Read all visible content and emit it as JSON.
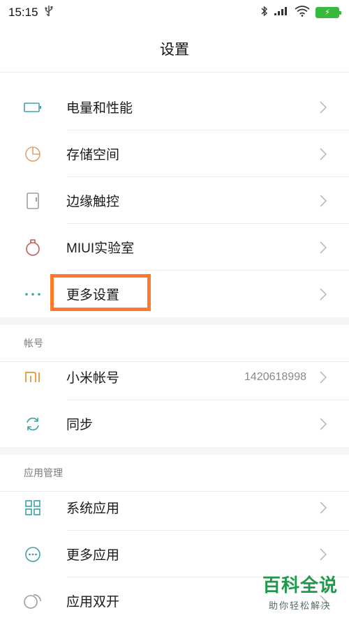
{
  "status_bar": {
    "time": "15:15"
  },
  "header": {
    "title": "设置"
  },
  "sections": {
    "top": {
      "items": [
        {
          "label": "电量和性能"
        },
        {
          "label": "存储空间"
        },
        {
          "label": "边缘触控"
        },
        {
          "label": "MIUI实验室"
        },
        {
          "label": "更多设置"
        }
      ]
    },
    "account": {
      "title": "帐号",
      "items": [
        {
          "label": "小米帐号",
          "value": "1420618998"
        },
        {
          "label": "同步"
        }
      ]
    },
    "apps": {
      "title": "应用管理",
      "items": [
        {
          "label": "系统应用"
        },
        {
          "label": "更多应用"
        },
        {
          "label": "应用双开"
        }
      ]
    }
  },
  "watermark": {
    "main": "百科全说",
    "sub": "助你轻松解决"
  },
  "colors": {
    "highlight": "#ff7a2a",
    "battery": "#36b93c",
    "accent_teal": "#3aa3a8",
    "mi_orange": "#e8a34a"
  }
}
